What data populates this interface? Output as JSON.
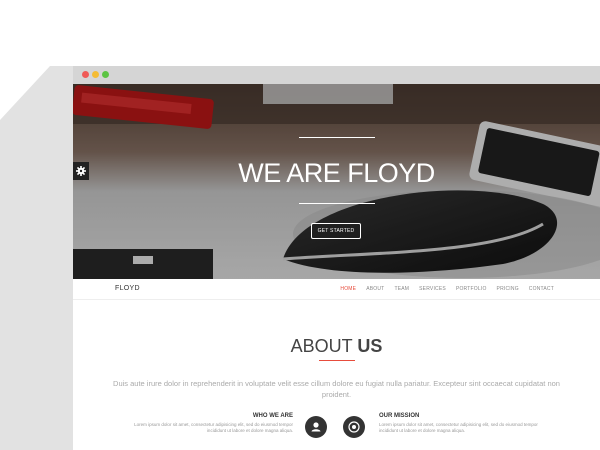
{
  "hero": {
    "title": "WE ARE FLOYD",
    "cta_label": "GET STARTED"
  },
  "navbar": {
    "brand": "FLOYD",
    "items": [
      {
        "label": "HOME",
        "active": true
      },
      {
        "label": "ABOUT",
        "active": false
      },
      {
        "label": "TEAM",
        "active": false
      },
      {
        "label": "SERVICES",
        "active": false
      },
      {
        "label": "PORTFOLIO",
        "active": false
      },
      {
        "label": "PRICING",
        "active": false
      },
      {
        "label": "CONTACT",
        "active": false
      }
    ]
  },
  "about": {
    "title_light": "ABOUT",
    "title_bold": "US",
    "text": "Duis aute irure dolor in reprehenderit in voluptate velit esse cillum dolore eu fugiat nulla pariatur. Excepteur sint occaecat cupidatat non proident.",
    "columns": [
      {
        "title": "WHO WE ARE",
        "text": "Lorem ipsum dolor sit amet, consectetur adipisicing elit, sed do eiusmod tempor incididunt ut labore et dolore magna aliqua.",
        "icon": "user-icon"
      },
      {
        "title": "OUR MISSION",
        "text": "Lorem ipsum dolor sit amet, consectetur adipisicing elit, sed do eiusmod tempor incididunt ut labore et dolore magna aliqua.",
        "icon": "target-icon"
      }
    ]
  },
  "colors": {
    "accent": "#e74c3c",
    "titlebar": "#d5d5d5",
    "dark_circle": "#333333"
  }
}
